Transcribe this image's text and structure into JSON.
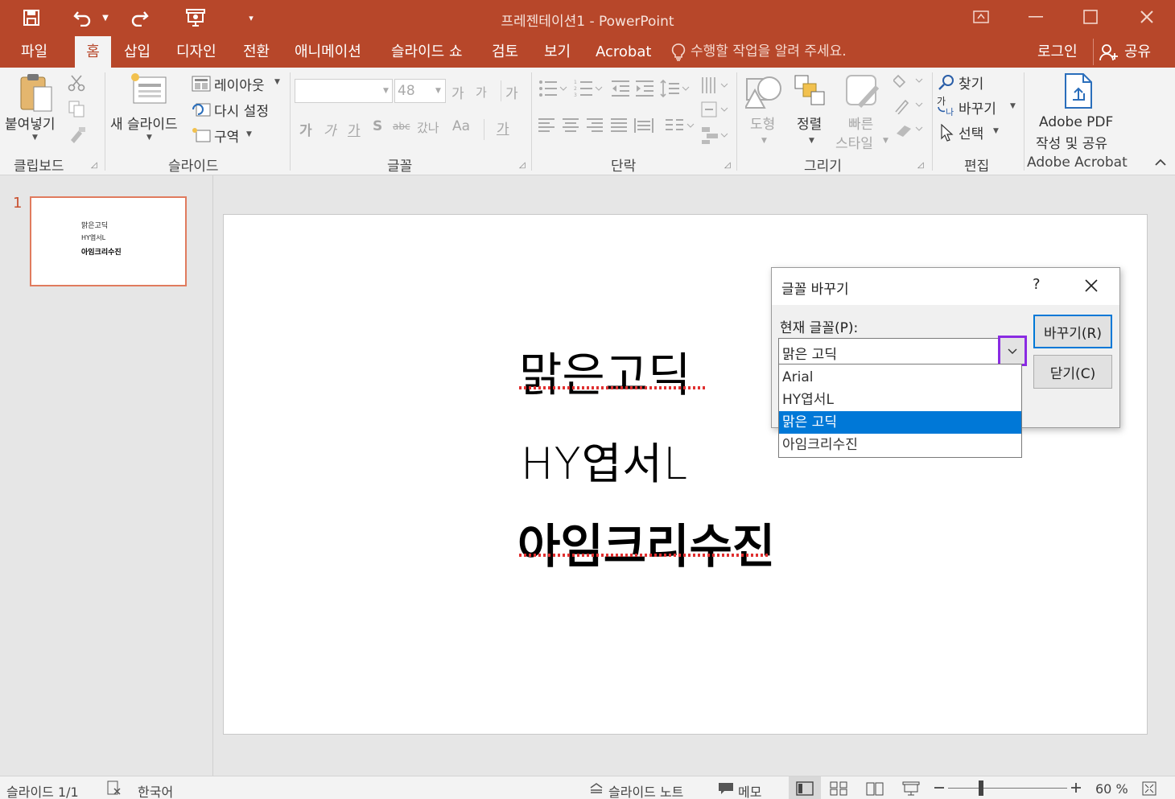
{
  "window": {
    "title": "프레젠테이션1  -  PowerPoint"
  },
  "tabs": [
    "파일",
    "홈",
    "삽입",
    "디자인",
    "전환",
    "애니메이션",
    "슬라이드 쇼",
    "검토",
    "보기",
    "Acrobat"
  ],
  "tell_me": "수행할 작업을 알려 주세요.",
  "account": {
    "signin": "로그인",
    "share": "공유"
  },
  "ribbon": {
    "clipboard": {
      "paste": "붙여넣기",
      "label": "클립보드"
    },
    "slides": {
      "new_slide_line1": "새 슬라이드",
      "layout": "레이아웃",
      "reset": "다시 설정",
      "section": "구역",
      "label": "슬라이드"
    },
    "font": {
      "size": "48",
      "grow": "가",
      "shrink": "가",
      "bold": "가",
      "italic": "가",
      "underline": "가",
      "shadow": "S",
      "strike": "abc",
      "spacing": "갔나",
      "case": "Aa",
      "color": "가",
      "label": "글꼴"
    },
    "paragraph": {
      "label": "단락"
    },
    "drawing": {
      "shapes": "도형",
      "arrange": "정렬",
      "quick_styles_1": "빠른",
      "quick_styles_2": "스타일",
      "label": "그리기"
    },
    "editing": {
      "find": "찾기",
      "replace": "바꾸기",
      "select": "선택",
      "label": "편집"
    },
    "acrobat": {
      "create_1": "Adobe PDF",
      "create_2": "작성 및 공유",
      "label": "Adobe Acrobat"
    }
  },
  "thumbnail": {
    "number": "1",
    "lines": [
      "맑은고딕",
      "HY엽서L",
      "아임크리수진"
    ]
  },
  "slide": {
    "lines": [
      "맑은고딕",
      "HY엽서L",
      "아임크리수진"
    ]
  },
  "dialog": {
    "title": "글꼴 바꾸기",
    "help": "?",
    "current_font_label": "현재 글꼴(P):",
    "current_font_value": "맑은 고딕",
    "replace_button": "바꾸기(R)",
    "close_button": "닫기(C)",
    "options": [
      "Arial",
      "HY엽서L",
      "맑은 고딕",
      "아임크리수진"
    ],
    "selected_option": "맑은 고딕"
  },
  "statusbar": {
    "slide_indicator": "슬라이드 1/1",
    "language": "한국어",
    "notes": "슬라이드 노트",
    "comments": "메모",
    "zoom": "60 %"
  },
  "colors": {
    "accent": "#b7472a",
    "selection": "#0078d7",
    "highlight_box": "#8a2be2"
  }
}
